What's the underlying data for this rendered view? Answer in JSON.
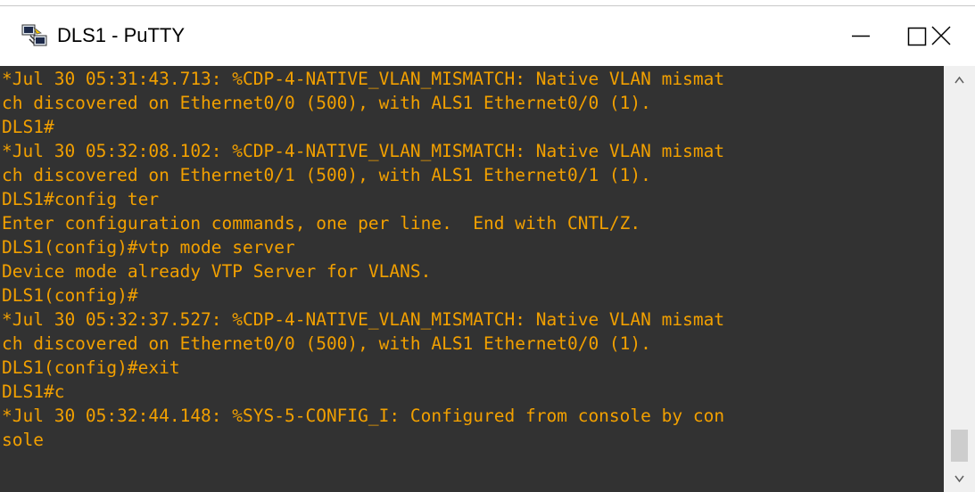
{
  "window": {
    "title": "DLS1 - PuTTY",
    "app_icon": "putty-icon",
    "controls": {
      "minimize_icon": "minimize-icon",
      "maximize_icon": "maximize-icon",
      "close_icon": "close-icon"
    }
  },
  "terminal": {
    "text_color": "#f2a000",
    "background_color": "#323232",
    "lines": [
      "*Jul 30 05:31:43.713: %CDP-4-NATIVE_VLAN_MISMATCH: Native VLAN mismat",
      "ch discovered on Ethernet0/0 (500), with ALS1 Ethernet0/0 (1).",
      "DLS1#",
      "*Jul 30 05:32:08.102: %CDP-4-NATIVE_VLAN_MISMATCH: Native VLAN mismat",
      "ch discovered on Ethernet0/1 (500), with ALS1 Ethernet0/1 (1).",
      "DLS1#config ter",
      "Enter configuration commands, one per line.  End with CNTL/Z.",
      "DLS1(config)#vtp mode server",
      "Device mode already VTP Server for VLANS.",
      "DLS1(config)#",
      "*Jul 30 05:32:37.527: %CDP-4-NATIVE_VLAN_MISMATCH: Native VLAN mismat",
      "ch discovered on Ethernet0/0 (500), with ALS1 Ethernet0/0 (1).",
      "DLS1(config)#exit",
      "DLS1#c",
      "*Jul 30 05:32:44.148: %SYS-5-CONFIG_I: Configured from console by con",
      "sole"
    ]
  },
  "scrollbar": {
    "up_icon": "scroll-up-arrow-icon",
    "down_icon": "scroll-down-arrow-icon"
  }
}
